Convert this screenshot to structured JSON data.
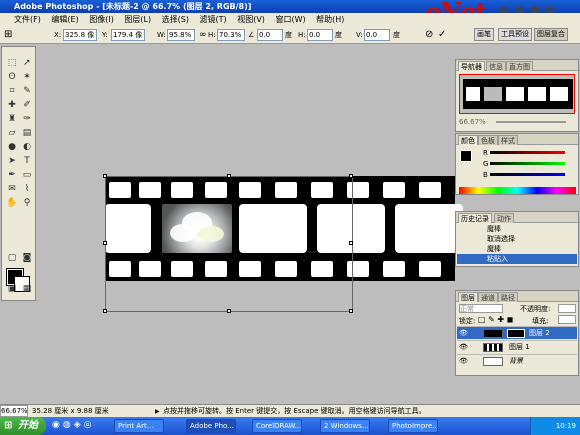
{
  "window": {
    "title": "Adobe Photoshop - [未标题-2 @ 66.7% (图层 2, RGB/8)]"
  },
  "watermark": {
    "logo": "eNet",
    "sub": "网 络 学 院"
  },
  "menu": [
    "文件(F)",
    "编辑(E)",
    "图像(I)",
    "图层(L)",
    "选择(S)",
    "滤镜(T)",
    "视图(V)",
    "窗口(W)",
    "帮助(H)"
  ],
  "options": {
    "x_label": "X:",
    "x_value": "325.8 像",
    "y_label": "Y:",
    "y_value": "179.4 像",
    "w_label": "W:",
    "w_value": "95.8%",
    "h_label": "H:",
    "h_value": "70.3%",
    "angle_value": "0.0",
    "angle_unit": "度",
    "hskew_label": "H:",
    "hskew_value": "0.0",
    "hskew_unit": "度",
    "vskew_label": "V:",
    "vskew_value": "0.0",
    "vskew_unit": "度",
    "btn_brush": "画笔",
    "btn_toolpreset": "工具预设",
    "btn_layercomp": "图层复合"
  },
  "nav_panel": {
    "tabs": [
      "导航器",
      "信息",
      "直方图"
    ],
    "zoom": "66.67%"
  },
  "color_panel": {
    "tabs": [
      "颜色",
      "色板",
      "样式"
    ],
    "r": "R",
    "g": "G",
    "b": "B"
  },
  "history_panel": {
    "tabs": [
      "历史记录",
      "动作"
    ],
    "items": [
      "魔棒",
      "取消选择",
      "魔棒",
      "粘贴入"
    ],
    "current_index": 3
  },
  "layers_panel": {
    "tabs": [
      "图层",
      "通道",
      "路径"
    ],
    "blend_mode": "正常",
    "opacity_label": "不透明度:",
    "lock_label": "锁定:",
    "fill_label": "填充:",
    "layers": [
      {
        "name": "图层 2",
        "selected": true
      },
      {
        "name": "图层 1",
        "selected": false
      },
      {
        "name": "背景",
        "selected": false
      }
    ]
  },
  "status": {
    "zoom": "66.67%",
    "doc_size": "35.28 厘米 x 9.88 厘米",
    "hint": "点按并拖移可旋转。按 Enter 键提交，按 Escape 键取消。用空格键访问导航工具。"
  },
  "taskbar": {
    "start": "开始",
    "tasks": [
      "Print Art...",
      "Adobe Pho...",
      "CorelDRAW...",
      "2 Windows...",
      "PhotoImpre..."
    ],
    "clock": "10:19"
  },
  "colors": {
    "titlebar": "#0a3fb0",
    "selection": "#316ac5",
    "logo": "#c41010"
  }
}
